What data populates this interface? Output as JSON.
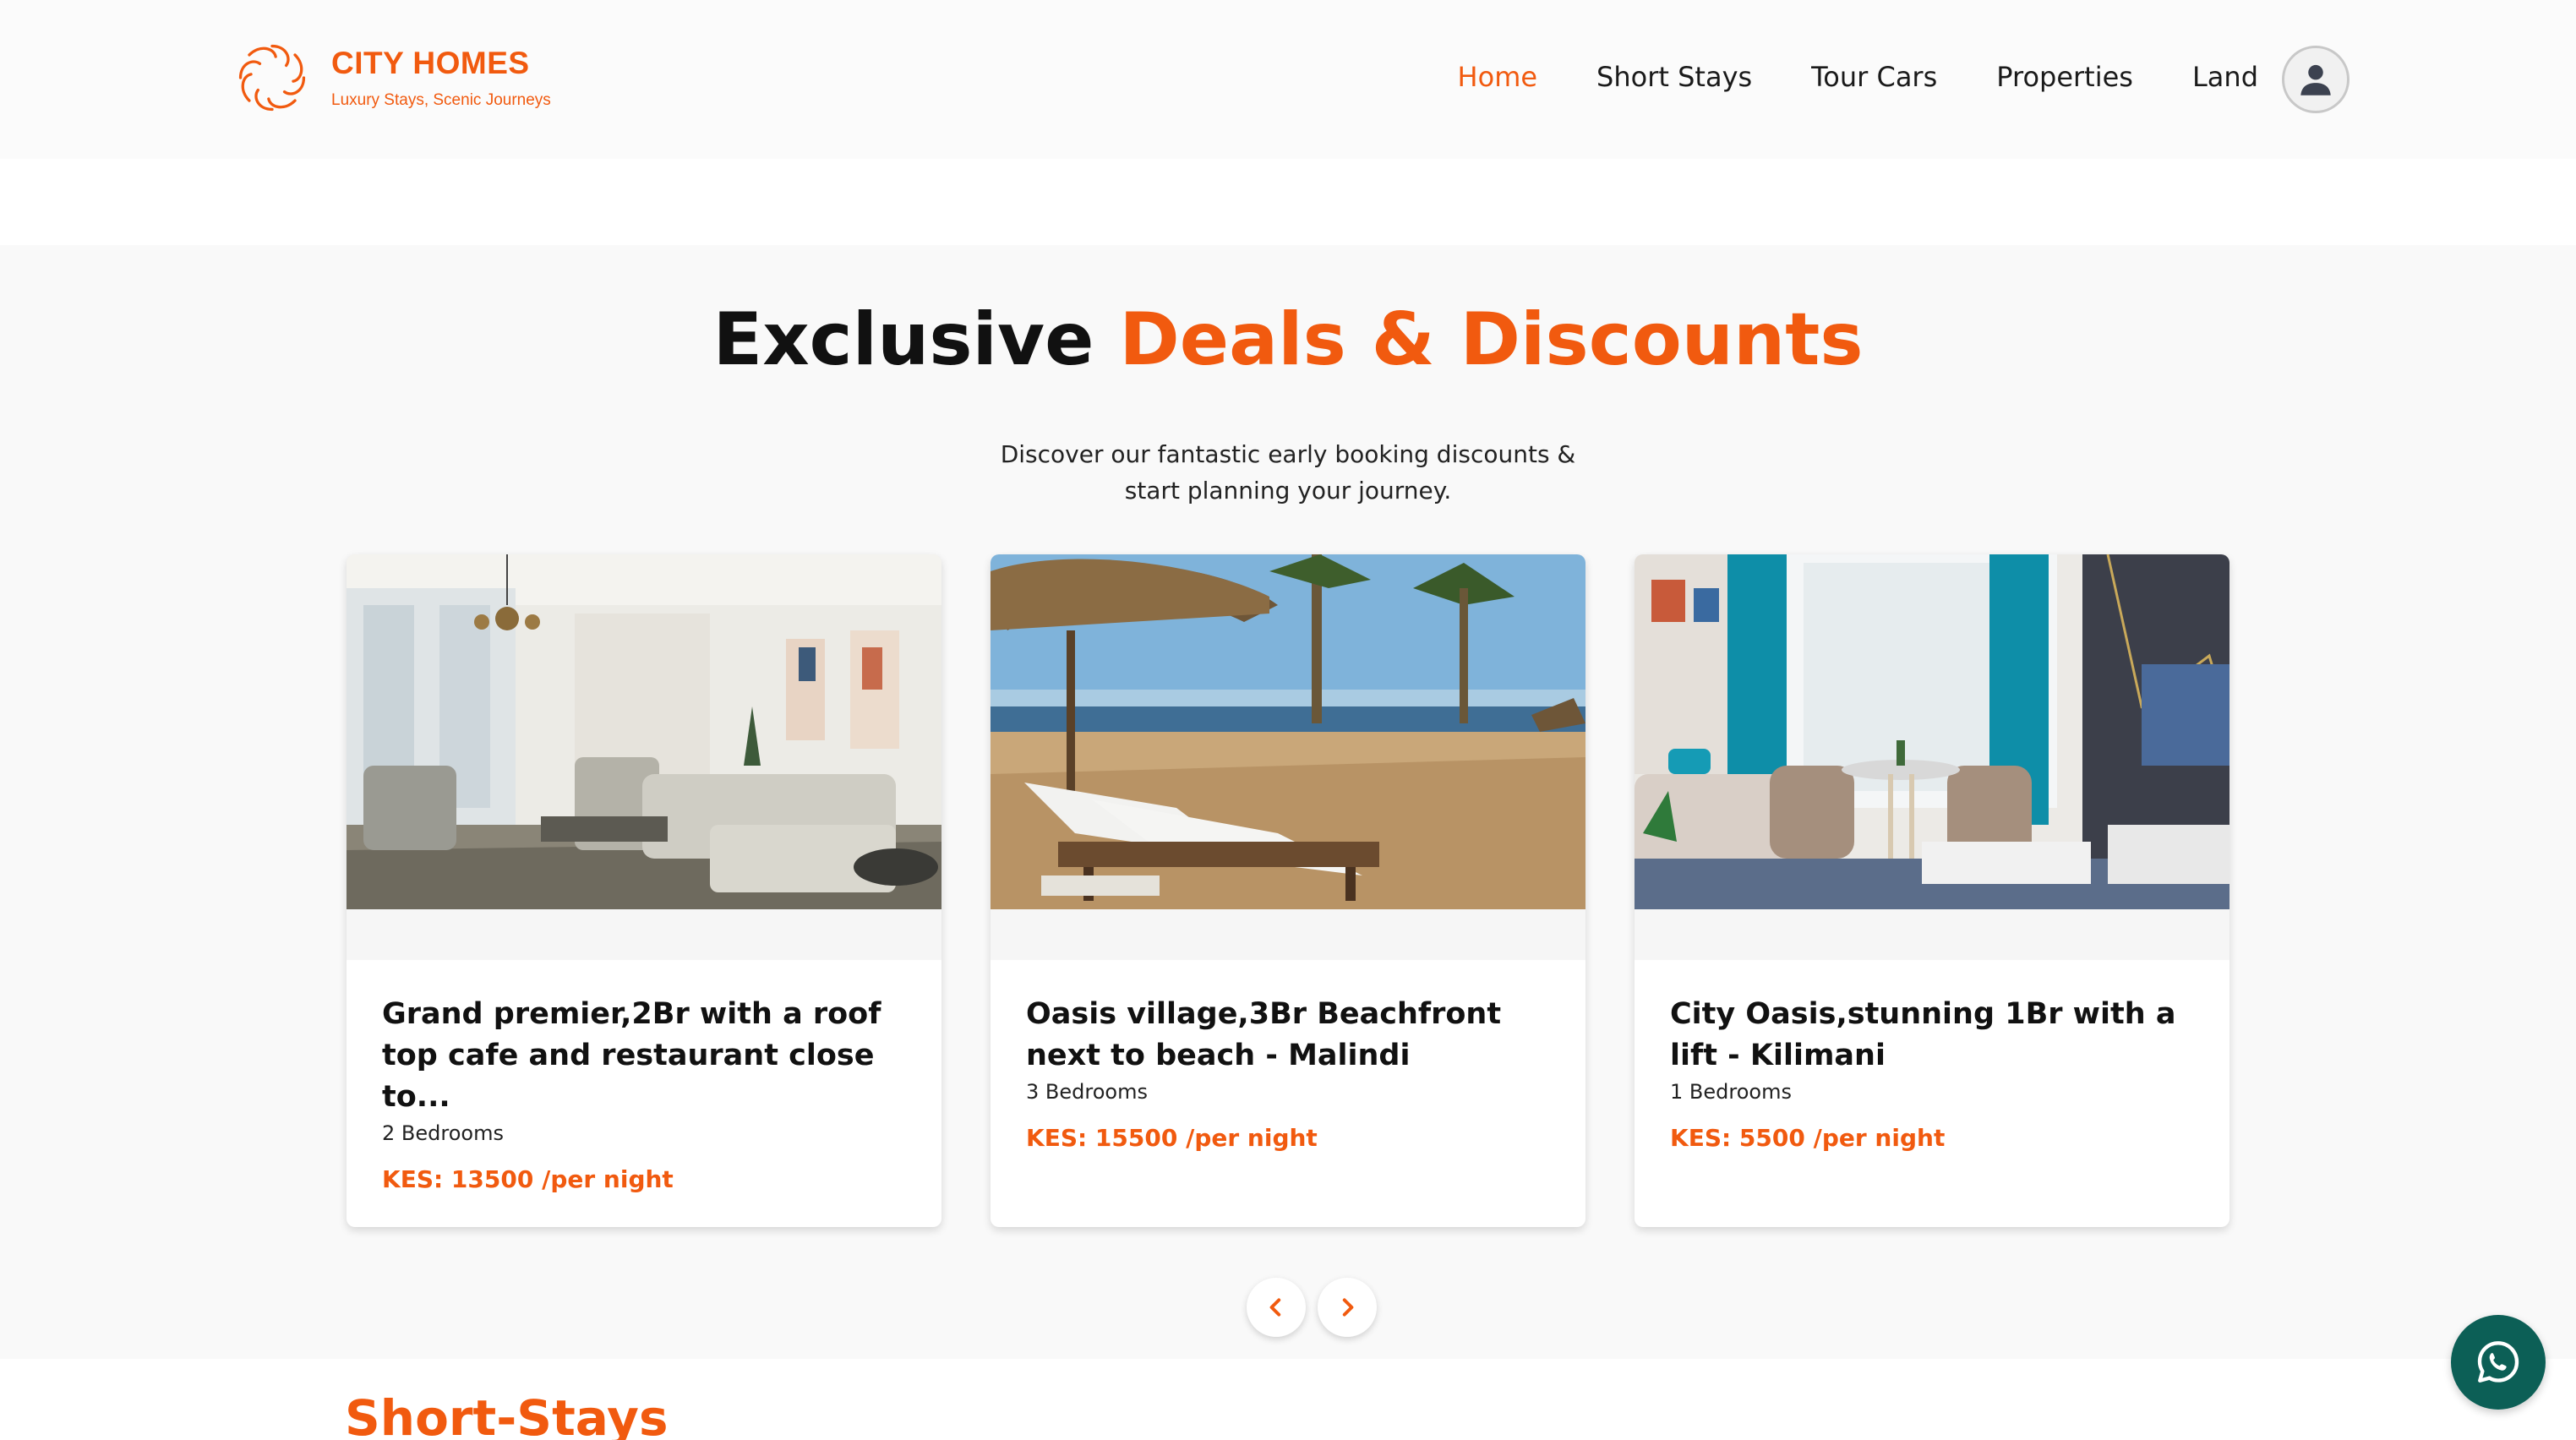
{
  "brand": {
    "name": "CITY HOMES",
    "tagline": "Luxury Stays, Scenic Journeys",
    "color": "#f15a0f"
  },
  "nav": {
    "items": [
      {
        "label": "Home",
        "active": true
      },
      {
        "label": "Short Stays",
        "active": false
      },
      {
        "label": "Tour Cars",
        "active": false
      },
      {
        "label": "Properties",
        "active": false
      },
      {
        "label": "Land",
        "active": false
      }
    ],
    "profile_icon": "user-icon"
  },
  "deals": {
    "heading_plain": "Exclusive",
    "heading_accent": "Deals & Discounts",
    "subtitle": "Discover our fantastic early booking discounts & start planning your journey.",
    "cards": [
      {
        "title": "Grand premier,2Br with a roof top cafe and restaurant close to...",
        "bedrooms": "2 Bedrooms",
        "price": "KES: 13500 /per night",
        "image": "living-room-photo"
      },
      {
        "title": "Oasis village,3Br Beachfront next to beach - Malindi",
        "bedrooms": "3 Bedrooms",
        "price": "KES: 15500 /per night",
        "image": "beach-loungers-photo"
      },
      {
        "title": "City Oasis,stunning 1Br with a lift - Kilimani",
        "bedrooms": "1 Bedrooms",
        "price": "KES: 5500 /per night",
        "image": "teal-curtains-living-room-photo"
      }
    ],
    "prev_icon": "chevron-left-icon",
    "next_icon": "chevron-right-icon"
  },
  "short_stays": {
    "heading": "Short-Stays"
  },
  "whatsapp": {
    "icon": "whatsapp-icon",
    "color": "#0c5f56"
  }
}
